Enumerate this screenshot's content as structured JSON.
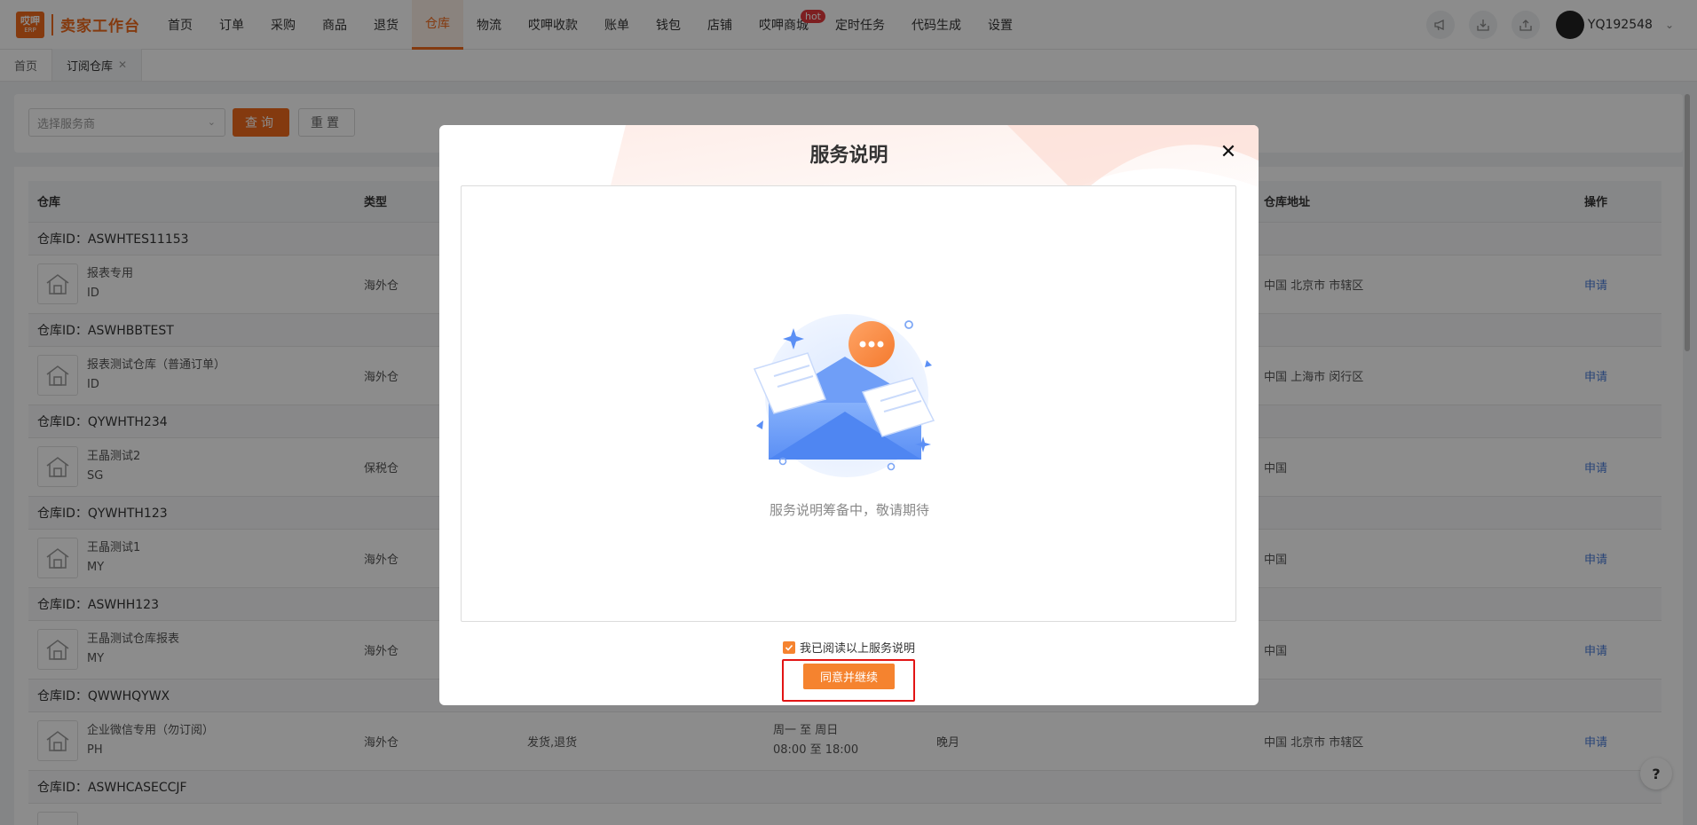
{
  "brand": {
    "logo_line1": "哎呷",
    "logo_line2": "ERP",
    "name": "卖家工作台"
  },
  "nav": {
    "items": [
      {
        "label": "首页"
      },
      {
        "label": "订单"
      },
      {
        "label": "采购"
      },
      {
        "label": "商品"
      },
      {
        "label": "退货"
      },
      {
        "label": "仓库",
        "active": true
      },
      {
        "label": "物流"
      },
      {
        "label": "哎呷收款"
      },
      {
        "label": "账单"
      },
      {
        "label": "钱包"
      },
      {
        "label": "店铺"
      },
      {
        "label": "哎呷商城",
        "badge": "hot"
      },
      {
        "label": "定时任务"
      },
      {
        "label": "代码生成"
      },
      {
        "label": "设置"
      }
    ],
    "hot_badge": "hot",
    "username": "YQ192548",
    "accent": "#f06a1d"
  },
  "tabs": [
    {
      "label": "首页"
    },
    {
      "label": "订阅仓库",
      "active": true
    }
  ],
  "filter": {
    "select_placeholder": "选择服务商",
    "query_label": "查询",
    "reset_label": "重置"
  },
  "table": {
    "headers": {
      "warehouse": "仓库",
      "type": "类型",
      "address": "仓库地址",
      "action": "操作"
    },
    "groups": [
      {
        "id_label": "仓库ID：ASWHTES11153",
        "name": "报表专用",
        "country": "ID",
        "type": "海外仓",
        "address": "中国 北京市 市辖区",
        "action": "申请"
      },
      {
        "id_label": "仓库ID：ASWHBBTEST",
        "name": "报表测试仓库（普通订单）",
        "country": "ID",
        "type": "海外仓",
        "address": "中国 上海市 闵行区",
        "action": "申请"
      },
      {
        "id_label": "仓库ID：QYWHTH234",
        "name": "王晶测试2",
        "country": "SG",
        "type": "保税仓",
        "address": "中国",
        "action": "申请"
      },
      {
        "id_label": "仓库ID：QYWHTH123",
        "name": "王晶测试1",
        "country": "MY",
        "type": "海外仓",
        "address": "中国",
        "action": "申请"
      },
      {
        "id_label": "仓库ID：ASWHH123",
        "name": "王晶测试仓库报表",
        "country": "MY",
        "type": "海外仓",
        "address": "中国",
        "action": "申请"
      },
      {
        "id_label": "仓库ID：QWWHQYWX",
        "name": "企业微信专用（勿订阅）",
        "country": "PH",
        "type": "海外仓",
        "business": "发货,退货",
        "hours_days": "周一 至 周日",
        "hours_time": "08:00 至 18:00",
        "settlement": "晚月",
        "address": "中国 北京市 市辖区",
        "action": "申请"
      },
      {
        "id_label": "仓库ID：ASWHCASECCJF"
      }
    ]
  },
  "modal": {
    "title": "服务说明",
    "empty_text": "服务说明筹备中，敬请期待",
    "checkbox_label": "我已阅读以上服务说明",
    "checkbox_checked": true,
    "agree_label": "同意并继续",
    "accent": "#f5832f",
    "highlight_color": "#e21414"
  },
  "help": {
    "label": "?"
  }
}
